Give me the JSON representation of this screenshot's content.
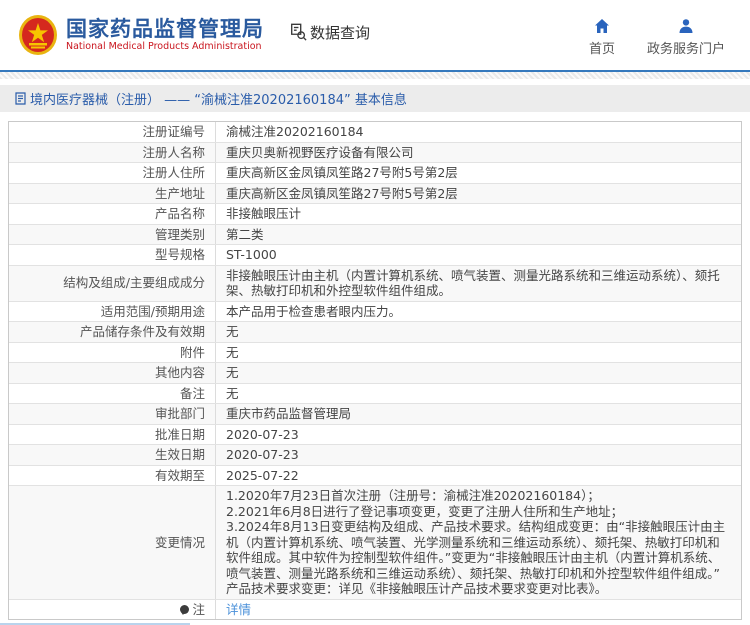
{
  "header": {
    "agency_name_cn": "国家药品监督管理局",
    "agency_name_en": "National Medical Products Administration",
    "data_query_label": "数据查询",
    "nav_home_label": "首页",
    "nav_portal_label": "政务服务门户"
  },
  "page_title": "境内医疗器械（注册） —— “渝械注准20202160184” 基本信息",
  "table": {
    "rows": [
      {
        "label": "注册证编号",
        "value": "渝械注准20202160184"
      },
      {
        "label": "注册人名称",
        "value": "重庆贝奥新视野医疗设备有限公司"
      },
      {
        "label": "注册人住所",
        "value": "重庆高新区金凤镇凤笙路27号附5号第2层"
      },
      {
        "label": "生产地址",
        "value": "重庆高新区金凤镇凤笙路27号附5号第2层"
      },
      {
        "label": "产品名称",
        "value": "非接触眼压计"
      },
      {
        "label": "管理类别",
        "value": "第二类"
      },
      {
        "label": "型号规格",
        "value": "ST-1000"
      },
      {
        "label": "结构及组成/主要组成成分",
        "value": "非接触眼压计由主机（内置计算机系统、喷气装置、测量光路系统和三维运动系统）、颏托架、热敏打印机和外控型软件组件组成。"
      },
      {
        "label": "适用范围/预期用途",
        "value": "本产品用于检查患者眼内压力。"
      },
      {
        "label": "产品储存条件及有效期",
        "value": "无"
      },
      {
        "label": "附件",
        "value": "无"
      },
      {
        "label": "其他内容",
        "value": "无"
      },
      {
        "label": "备注",
        "value": "无"
      },
      {
        "label": "审批部门",
        "value": "重庆市药品监督管理局"
      },
      {
        "label": "批准日期",
        "value": "2020-07-23"
      },
      {
        "label": "生效日期",
        "value": "2020-07-23"
      },
      {
        "label": "有效期至",
        "value": "2025-07-22"
      },
      {
        "label": "变更情况",
        "value": "1.2020年7月23日首次注册（注册号：渝械注准20202160184）；\n2.2021年6月8日进行了登记事项变更，变更了注册人住所和生产地址；\n3.2024年8月13日变更结构及组成、产品技术要求。结构组成变更：由“非接触眼压计由主机（内置计算机系统、喷气装置、光学测量系统和三维运动系统）、颏托架、热敏打印机和软件组成。其中软件为控制型软件组件。”变更为“非接触眼压计由主机（内置计算机系统、喷气装置、测量光路系统和三维运动系统）、颏托架、热敏打印机和外控型软件组件组成。”\n产品技术要求变更：详见《非接触眼压计产品技术要求变更对比表》。"
      },
      {
        "label": "注",
        "value": "详情",
        "link": true,
        "icon": "note"
      }
    ]
  },
  "colors": {
    "brand_blue": "#2a5a9e",
    "brand_red": "#c9151e",
    "separator_blue": "#3579bd",
    "link_blue": "#4a90d9",
    "title_bar_bg": "#ececec"
  }
}
